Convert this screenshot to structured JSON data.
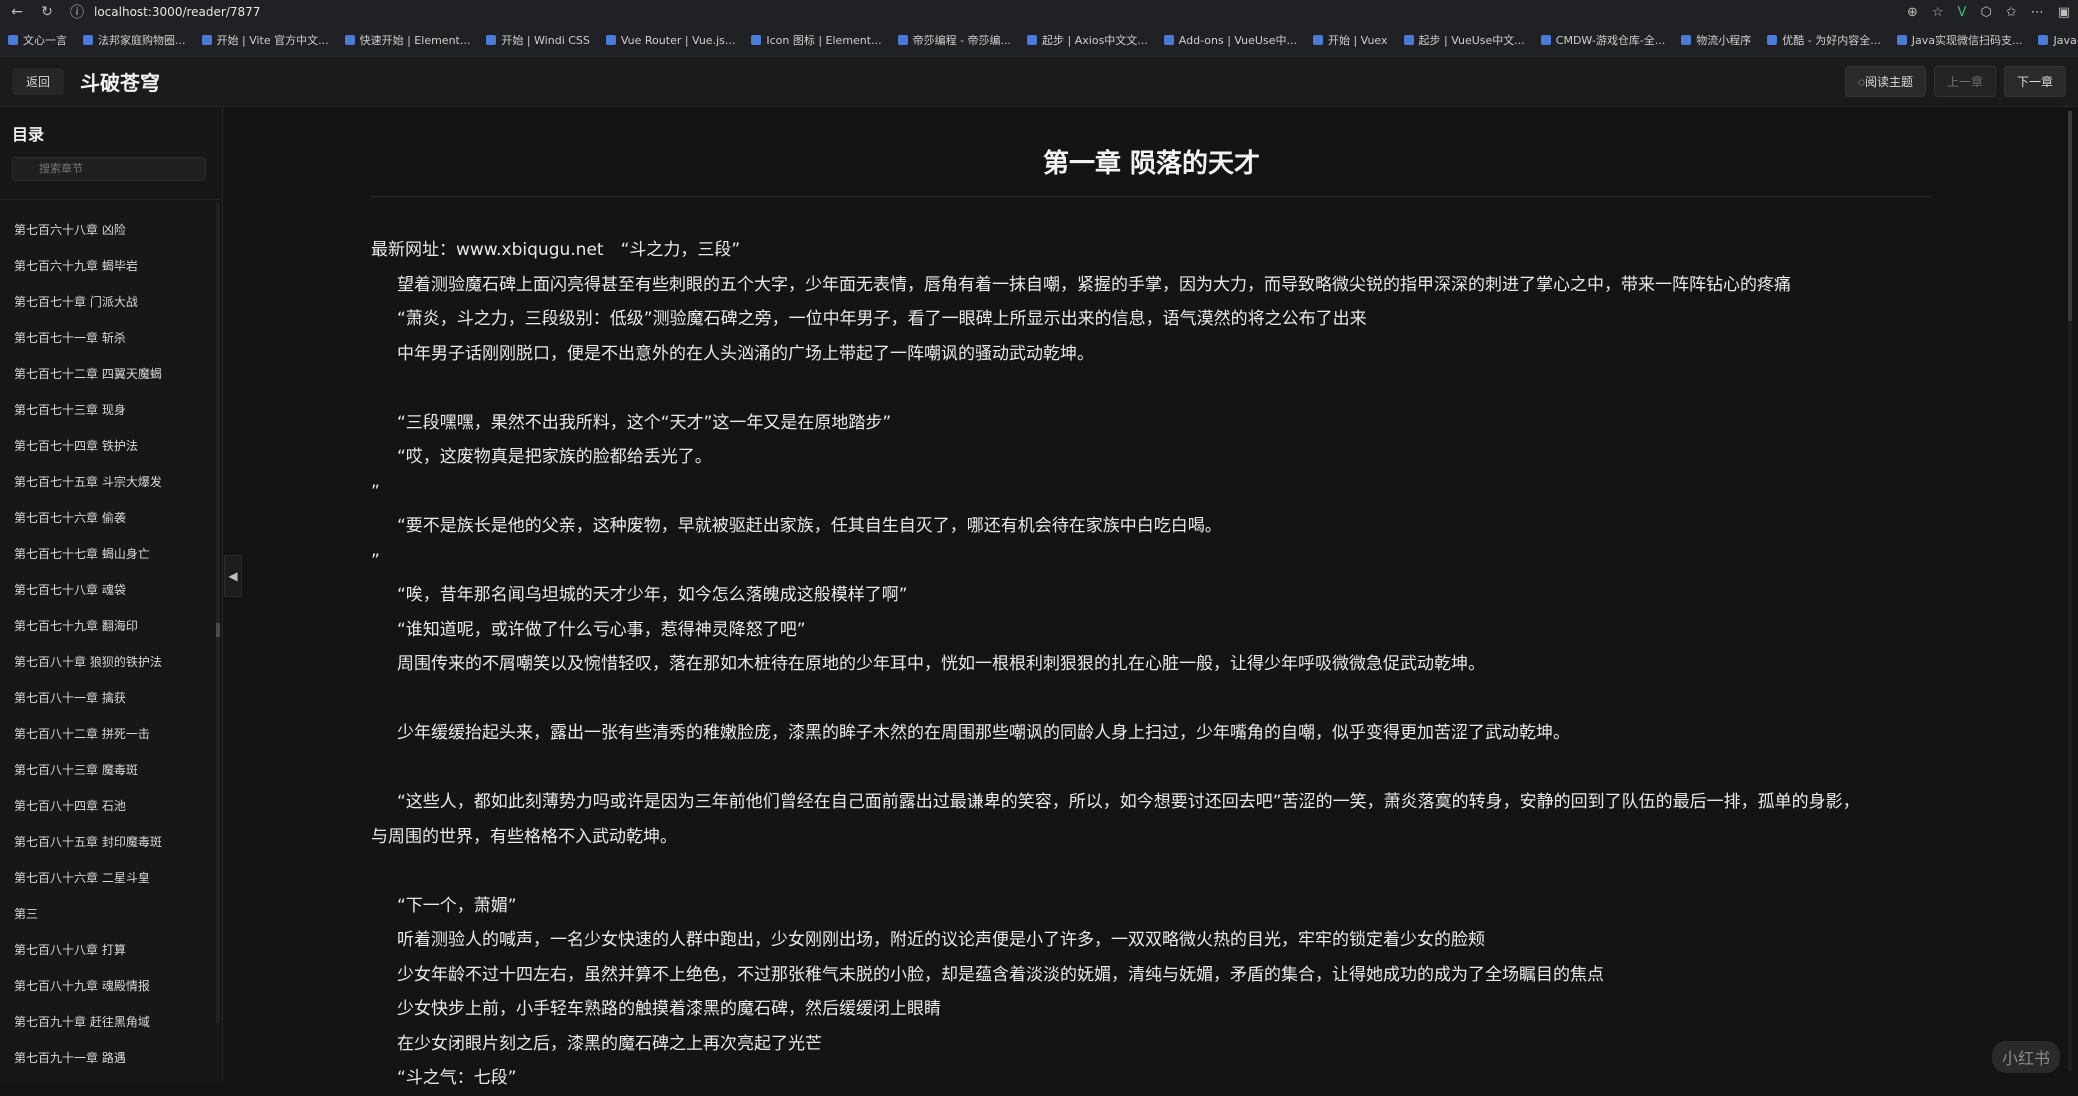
{
  "browser": {
    "url": "localhost:3000/reader/7877",
    "bookmarks": [
      "文心一言",
      "法邦家庭购物圈...",
      "开始 | Vite 官方中文...",
      "快速开始 | Element...",
      "开始 | Windi CSS",
      "Vue Router | Vue.js...",
      "Icon 图标 | Element...",
      "帝莎编程 - 帝莎编...",
      "起步 | Axios中文文...",
      "Add-ons | VueUse中...",
      "开始 | Vuex",
      "起步 | VueUse中文...",
      "CMDW-游戏仓库-全...",
      "物流小程序",
      "优酷 - 为好内容全...",
      "Java实现微信扫码支...",
      "Java—微信支付一小..."
    ]
  },
  "header": {
    "back_label": "返回",
    "book_title": "斗破苍穹",
    "theme_label": "阅读主题",
    "prev_label": "上一章",
    "next_label": "下一章"
  },
  "sidebar": {
    "title": "目录",
    "search_placeholder": "搜索章节",
    "items": [
      "第七百六十八章 凶险",
      "第七百六十九章 蝎毕岩",
      "第七百七十章 门派大战",
      "第七百七十一章 斩杀",
      "第七百七十二章 四翼天魔蝎",
      "第七百七十三章 现身",
      "第七百七十四章 铁护法",
      "第七百七十五章 斗宗大爆发",
      "第七百七十六章 偷袭",
      "第七百七十七章 蝎山身亡",
      "第七百七十八章 魂袋",
      "第七百七十九章 翻海印",
      "第七百八十章 狼狈的铁护法",
      "第七百八十一章 擒获",
      "第七百八十二章 拼死一击",
      "第七百八十三章 魔毒斑",
      "第七百八十四章 石池",
      "第七百八十五章 封印魔毒斑",
      "第七百八十六章 二星斗皇",
      "第三",
      "第七百八十八章 打算",
      "第七百八十九章 魂殿情报",
      "第七百九十章 赶往黑角域",
      "第七百九十一章 路遇"
    ]
  },
  "chapter": {
    "title": "第一章 陨落的天才",
    "paragraphs": [
      {
        "text": "最新网址：www.xbiqugu.net　“斗之力，三段”",
        "type": "first"
      },
      {
        "text": "望着测验魔石碑上面闪亮得甚至有些刺眼的五个大字，少年面无表情，唇角有着一抹自嘲，紧握的手掌，因为大力，而导致略微尖锐的指甲深深的刺进了掌心之中，带来一阵阵钻心的疼痛",
        "type": "indent"
      },
      {
        "text": "“萧炎，斗之力，三段级别：低级”测验魔石碑之旁，一位中年男子，看了一眼碑上所显示出来的信息，语气漠然的将之公布了出来",
        "type": "indent"
      },
      {
        "text": "中年男子话刚刚脱口，便是不出意外的在人头汹涌的广场上带起了一阵嘲讽的骚动武动乾坤。",
        "type": "indent"
      },
      {
        "text": "",
        "type": "blank"
      },
      {
        "text": "“三段嘿嘿，果然不出我所料，这个“天才”这一年又是在原地踏步”",
        "type": "indent"
      },
      {
        "text": "“哎，这废物真是把家族的脸都给丢光了。",
        "type": "indent"
      },
      {
        "text": "”",
        "type": "plain"
      },
      {
        "text": "“要不是族长是他的父亲，这种废物，早就被驱赶出家族，任其自生自灭了，哪还有机会待在家族中白吃白喝。",
        "type": "indent"
      },
      {
        "text": "”",
        "type": "plain"
      },
      {
        "text": "“唉，昔年那名闻乌坦城的天才少年，如今怎么落魄成这般模样了啊”",
        "type": "indent"
      },
      {
        "text": "“谁知道呢，或许做了什么亏心事，惹得神灵降怒了吧”",
        "type": "indent"
      },
      {
        "text": "周围传来的不屑嘲笑以及惋惜轻叹，落在那如木桩待在原地的少年耳中，恍如一根根利刺狠狠的扎在心脏一般，让得少年呼吸微微急促武动乾坤。",
        "type": "indent"
      },
      {
        "text": "",
        "type": "blank"
      },
      {
        "text": "少年缓缓抬起头来，露出一张有些清秀的稚嫩脸庞，漆黑的眸子木然的在周围那些嘲讽的同龄人身上扫过，少年嘴角的自嘲，似乎变得更加苦涩了武动乾坤。",
        "type": "indent"
      },
      {
        "text": "",
        "type": "blank"
      },
      {
        "text": "“这些人，都如此刻薄势力吗或许是因为三年前他们曾经在自己面前露出过最谦卑的笑容，所以，如今想要讨还回去吧”苦涩的一笑，萧炎落寞的转身，安静的回到了队伍的最后一排，孤单的身影，",
        "type": "indent"
      },
      {
        "text": "与周围的世界，有些格格不入武动乾坤。",
        "type": "plain"
      },
      {
        "text": "",
        "type": "blank"
      },
      {
        "text": "“下一个，萧媚”",
        "type": "indent"
      },
      {
        "text": "听着测验人的喊声，一名少女快速的人群中跑出，少女刚刚出场，附近的议论声便是小了许多，一双双略微火热的目光，牢牢的锁定着少女的脸颊",
        "type": "indent"
      },
      {
        "text": "少女年龄不过十四左右，虽然并算不上绝色，不过那张稚气未脱的小脸，却是蕴含着淡淡的妩媚，清纯与妩媚，矛盾的集合，让得她成功的成为了全场瞩目的焦点",
        "type": "indent"
      },
      {
        "text": "少女快步上前，小手轻车熟路的触摸着漆黑的魔石碑，然后缓缓闭上眼睛",
        "type": "indent"
      },
      {
        "text": "在少女闭眼片刻之后，漆黑的魔石碑之上再次亮起了光芒",
        "type": "indent"
      },
      {
        "text": "“斗之气：七段”",
        "type": "indent"
      }
    ]
  },
  "watermark": "小红书"
}
